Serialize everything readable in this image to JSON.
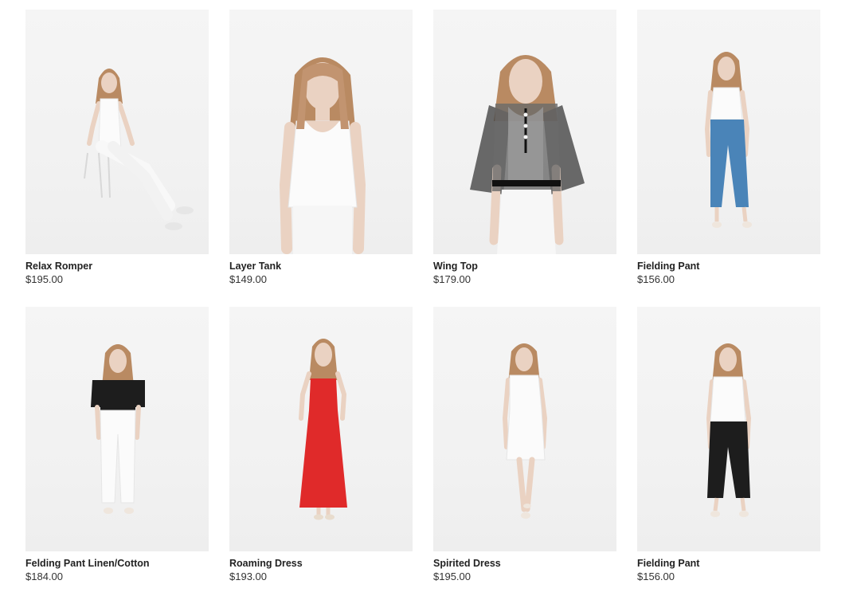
{
  "products": [
    {
      "name": "Relax Romper",
      "price": "$195.00"
    },
    {
      "name": "Layer Tank",
      "price": "$149.00"
    },
    {
      "name": "Wing Top",
      "price": "$179.00"
    },
    {
      "name": "Fielding Pant",
      "price": "$156.00"
    },
    {
      "name": "Felding Pant Linen/Cotton",
      "price": "$184.00"
    },
    {
      "name": "Roaming Dress",
      "price": "$193.00"
    },
    {
      "name": "Spirited Dress",
      "price": "$195.00"
    },
    {
      "name": "Fielding Pant",
      "price": "$156.00"
    }
  ],
  "colors": {
    "background": "#ffffff",
    "photo_background": "#f3f3f3",
    "hair": "#b98a62",
    "skin": "#ead2c2",
    "white_garment": "#fbfbfb",
    "black_garment": "#1d1d1d",
    "blue_pant": "#4a84b8",
    "red_dress": "#e02a2a"
  }
}
